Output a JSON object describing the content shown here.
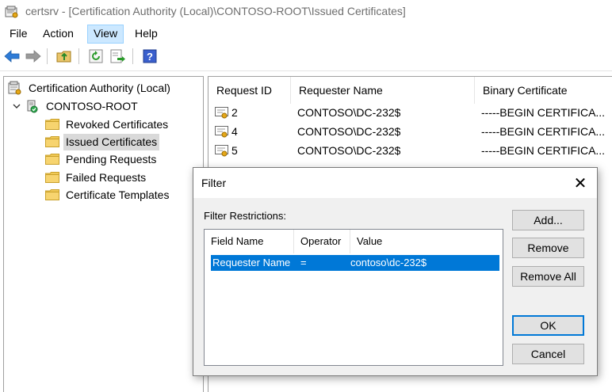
{
  "window": {
    "title": "certsrv - [Certification Authority (Local)\\CONTOSO-ROOT\\Issued Certificates]",
    "icon": "certsrv-icon"
  },
  "menu": [
    {
      "label": "File",
      "active": false
    },
    {
      "label": "Action",
      "active": false
    },
    {
      "label": "View",
      "active": true
    },
    {
      "label": "Help",
      "active": false
    }
  ],
  "toolbar": {
    "buttons": [
      "back-arrow-icon",
      "forward-arrow-icon",
      "up-folder-icon",
      "refresh-icon",
      "export-list-icon",
      "help-icon"
    ],
    "help_glyph": "?"
  },
  "tree": {
    "root": "Certification Authority (Local)",
    "ca": "CONTOSO-ROOT",
    "items": [
      {
        "label": "Revoked Certificates",
        "selected": false
      },
      {
        "label": "Issued Certificates",
        "selected": true
      },
      {
        "label": "Pending Requests",
        "selected": false
      },
      {
        "label": "Failed Requests",
        "selected": false
      },
      {
        "label": "Certificate Templates",
        "selected": false
      }
    ]
  },
  "list": {
    "columns": [
      "Request ID",
      "Requester Name",
      "Binary Certificate"
    ],
    "rows": [
      {
        "id": "2",
        "requester": "CONTOSO\\DC-232$",
        "binary": "-----BEGIN CERTIFICA..."
      },
      {
        "id": "4",
        "requester": "CONTOSO\\DC-232$",
        "binary": "-----BEGIN CERTIFICA..."
      },
      {
        "id": "5",
        "requester": "CONTOSO\\DC-232$",
        "binary": "-----BEGIN CERTIFICA..."
      }
    ]
  },
  "dialog": {
    "title": "Filter",
    "close_glyph": "✕",
    "section_label": "Filter Restrictions:",
    "columns": [
      "Field Name",
      "Operator",
      "Value"
    ],
    "restriction": {
      "field": "Requester Name",
      "operator": "=",
      "value": "contoso\\dc-232$"
    },
    "buttons": {
      "add": "Add...",
      "remove": "Remove",
      "remove_all": "Remove All",
      "ok": "OK",
      "cancel": "Cancel"
    }
  },
  "colors": {
    "selection": "#0078d7",
    "menu_active": "#cce8ff",
    "tree_selected": "#d9d9d9"
  }
}
